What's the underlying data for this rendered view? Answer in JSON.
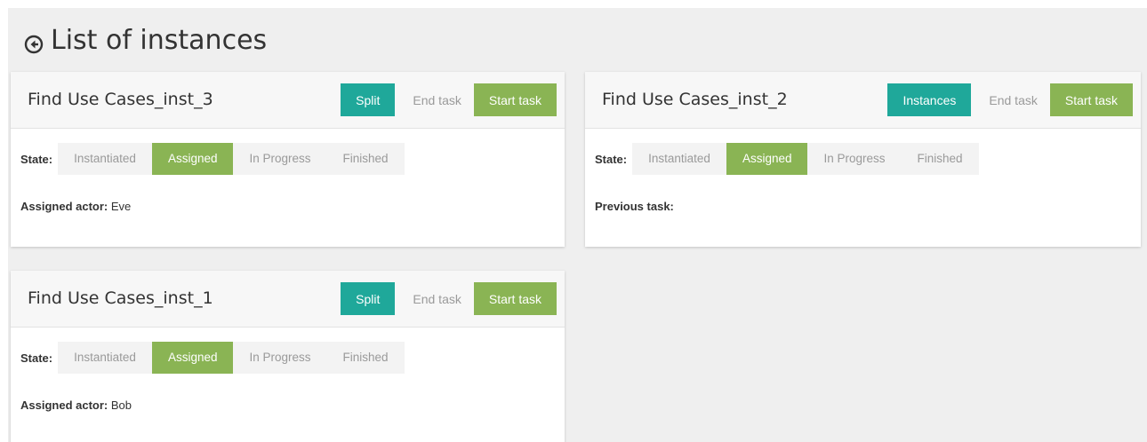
{
  "page": {
    "title": "List of instances"
  },
  "labels": {
    "state": "State:",
    "assigned_actor": "Assigned actor:",
    "previous_task": "Previous task:"
  },
  "states": [
    "Instantiated",
    "Assigned",
    "In Progress",
    "Finished"
  ],
  "colors": {
    "teal": "#1fa89a",
    "green": "#8ab454",
    "background": "#efefef"
  },
  "cards": [
    {
      "title": "Find Use Cases_inst_3",
      "buttons": {
        "primary": "Split",
        "end": "End task",
        "start": "Start task"
      },
      "active_state": "Assigned",
      "info_label": "Assigned actor:",
      "info_value": "Eve"
    },
    {
      "title": "Find Use Cases_inst_2",
      "buttons": {
        "primary": "Instances",
        "end": "End task",
        "start": "Start task"
      },
      "active_state": "Assigned",
      "info_label": "Previous task:",
      "info_value": ""
    },
    {
      "title": "Find Use Cases_inst_1",
      "buttons": {
        "primary": "Split",
        "end": "End task",
        "start": "Start task"
      },
      "active_state": "Assigned",
      "info_label": "Assigned actor:",
      "info_value": "Bob"
    }
  ]
}
